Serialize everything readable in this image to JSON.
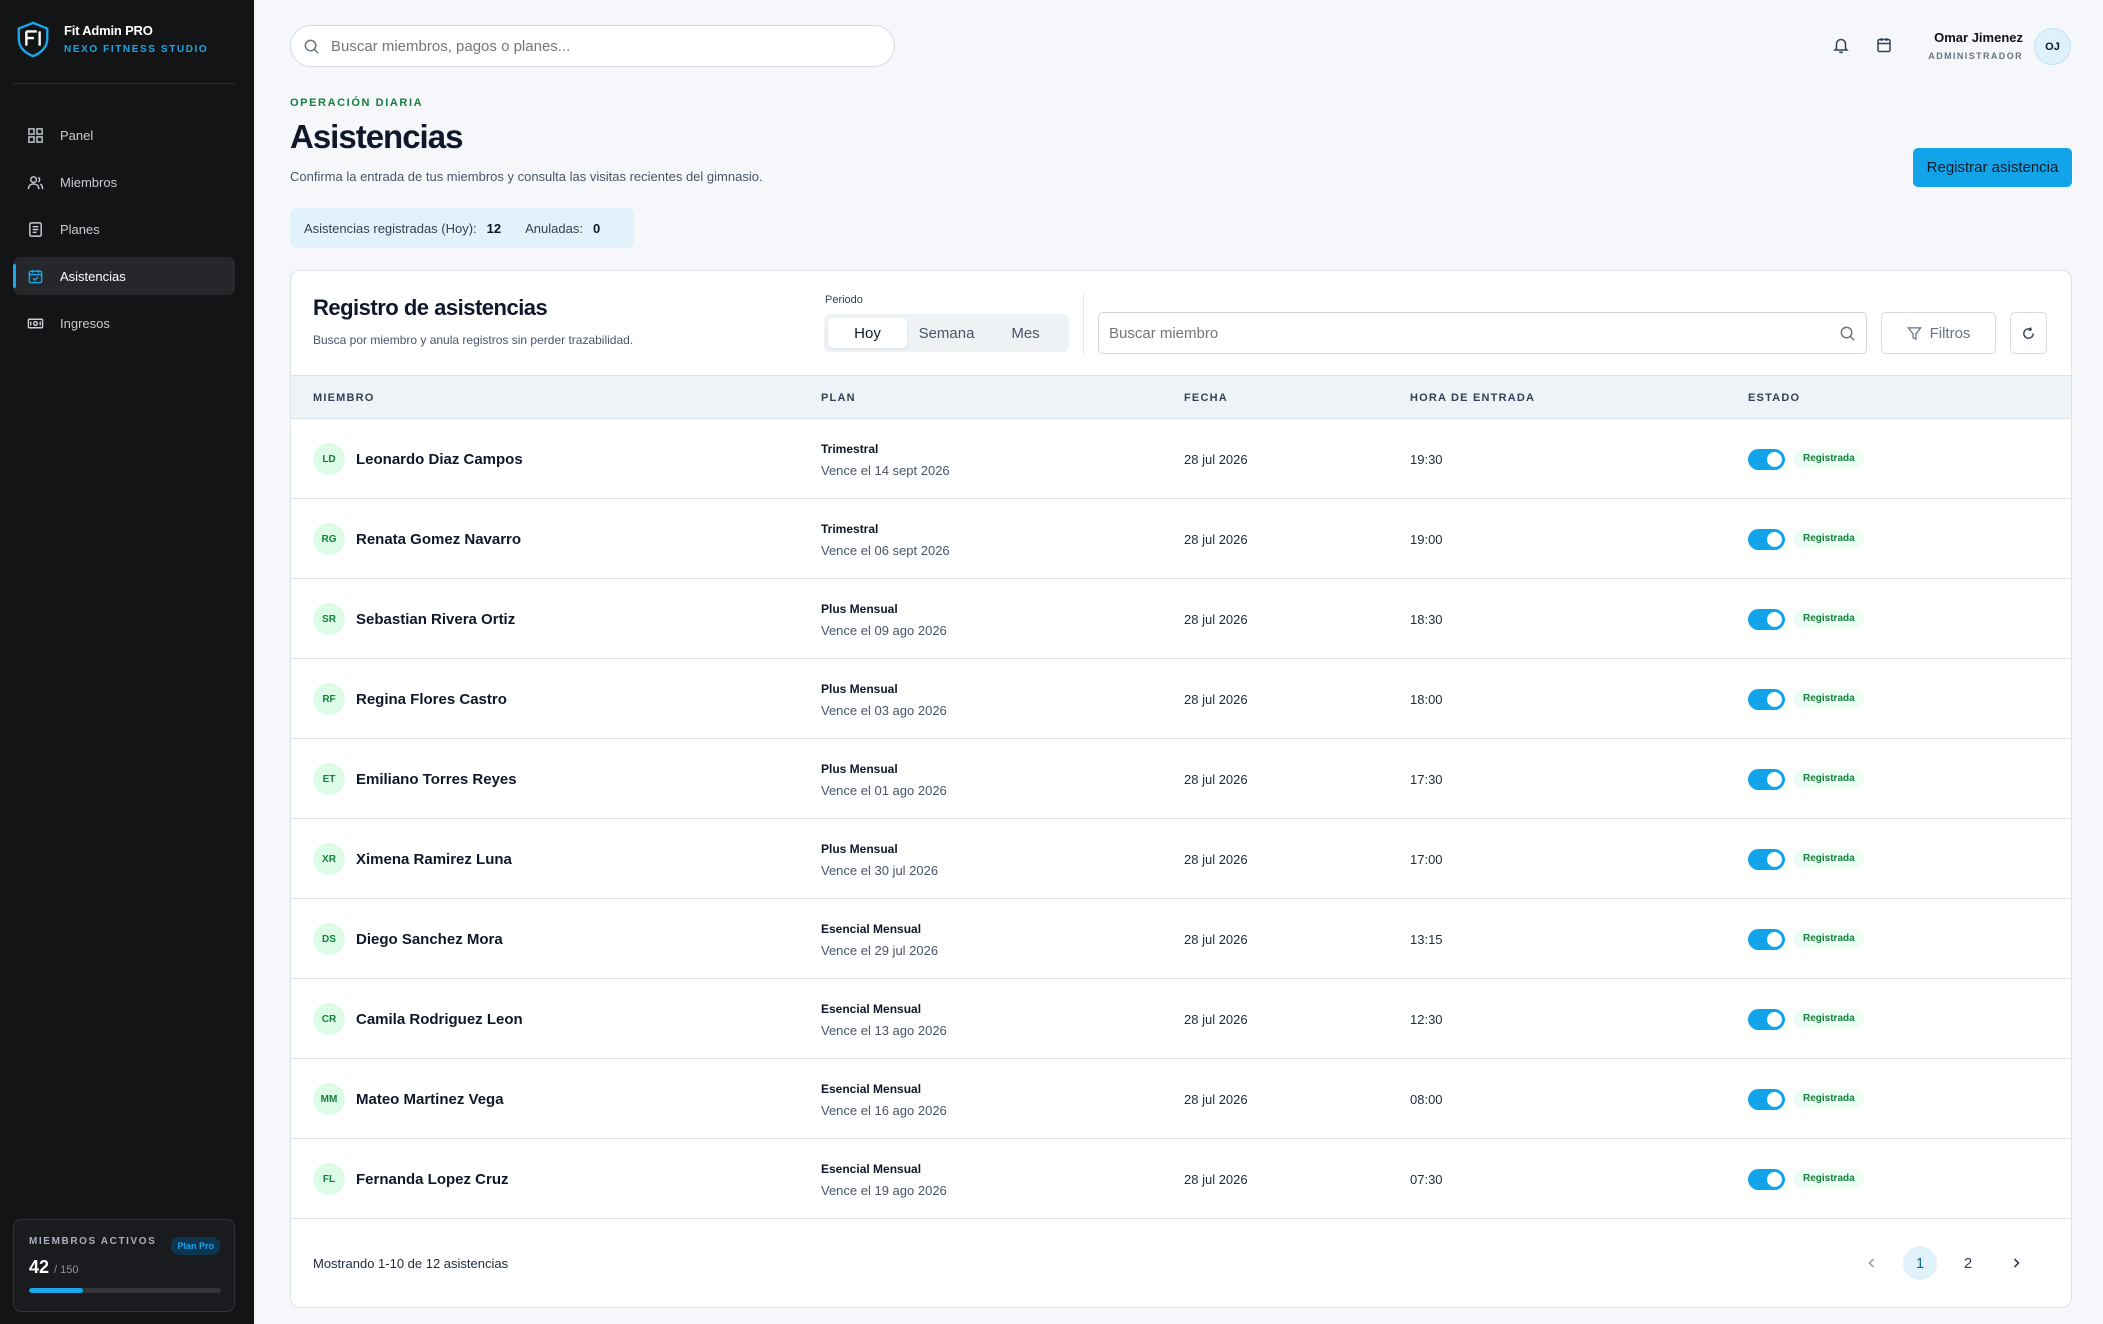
{
  "brand": {
    "title": "Fit Admin PRO",
    "subtitle": "NEXO FITNESS STUDIO"
  },
  "nav": [
    {
      "label": "Panel",
      "icon": "grid-icon"
    },
    {
      "label": "Miembros",
      "icon": "users-icon"
    },
    {
      "label": "Planes",
      "icon": "document-icon"
    },
    {
      "label": "Asistencias",
      "icon": "calendar-check-icon",
      "active": true
    },
    {
      "label": "Ingresos",
      "icon": "cash-icon"
    }
  ],
  "member_card": {
    "label": "MIEMBROS ACTIVOS",
    "badge": "Plan Pro",
    "count": "42",
    "total": "/ 150",
    "progress": 0.28
  },
  "topbar": {
    "search_placeholder": "Buscar miembros, pagos o planes...",
    "user_name": "Omar Jimenez",
    "user_role": "ADMINISTRADOR",
    "user_initials": "OJ"
  },
  "header": {
    "eyebrow": "OPERACIÓN DIARIA",
    "title": "Asistencias",
    "description": "Confirma la entrada de tus miembros y consulta las visitas recientes del gimnasio.",
    "primary_button": "Registrar asistencia"
  },
  "stats": {
    "registered_label": "Asistencias registradas (Hoy):",
    "registered_value": "12",
    "voided_label": "Anuladas:",
    "voided_value": "0"
  },
  "registry": {
    "title": "Registro de asistencias",
    "subtitle": "Busca por miembro y anula registros sin perder trazabilidad.",
    "period_label": "Periodo",
    "periods": [
      "Hoy",
      "Semana",
      "Mes"
    ],
    "search_placeholder": "Buscar miembro",
    "filters_label": "Filtros",
    "columns": [
      "MIEMBRO",
      "PLAN",
      "FECHA",
      "HORA DE ENTRADA",
      "ESTADO"
    ],
    "rows": [
      {
        "initials": "LD",
        "name": "Leonardo Diaz Campos",
        "plan": "Trimestral",
        "expires": "Vence el 14 sept 2026",
        "date": "28 jul 2026",
        "time": "19:30",
        "status": "Registrada"
      },
      {
        "initials": "RG",
        "name": "Renata Gomez Navarro",
        "plan": "Trimestral",
        "expires": "Vence el 06 sept 2026",
        "date": "28 jul 2026",
        "time": "19:00",
        "status": "Registrada"
      },
      {
        "initials": "SR",
        "name": "Sebastian Rivera Ortiz",
        "plan": "Plus Mensual",
        "expires": "Vence el 09 ago 2026",
        "date": "28 jul 2026",
        "time": "18:30",
        "status": "Registrada"
      },
      {
        "initials": "RF",
        "name": "Regina Flores Castro",
        "plan": "Plus Mensual",
        "expires": "Vence el 03 ago 2026",
        "date": "28 jul 2026",
        "time": "18:00",
        "status": "Registrada"
      },
      {
        "initials": "ET",
        "name": "Emiliano Torres Reyes",
        "plan": "Plus Mensual",
        "expires": "Vence el 01 ago 2026",
        "date": "28 jul 2026",
        "time": "17:30",
        "status": "Registrada"
      },
      {
        "initials": "XR",
        "name": "Ximena Ramirez Luna",
        "plan": "Plus Mensual",
        "expires": "Vence el 30 jul 2026",
        "date": "28 jul 2026",
        "time": "17:00",
        "status": "Registrada"
      },
      {
        "initials": "DS",
        "name": "Diego Sanchez Mora",
        "plan": "Esencial Mensual",
        "expires": "Vence el 29 jul 2026",
        "date": "28 jul 2026",
        "time": "13:15",
        "status": "Registrada"
      },
      {
        "initials": "CR",
        "name": "Camila Rodriguez Leon",
        "plan": "Esencial Mensual",
        "expires": "Vence el 13 ago 2026",
        "date": "28 jul 2026",
        "time": "12:30",
        "status": "Registrada"
      },
      {
        "initials": "MM",
        "name": "Mateo Martinez Vega",
        "plan": "Esencial Mensual",
        "expires": "Vence el 16 ago 2026",
        "date": "28 jul 2026",
        "time": "08:00",
        "status": "Registrada"
      },
      {
        "initials": "FL",
        "name": "Fernanda Lopez Cruz",
        "plan": "Esencial Mensual",
        "expires": "Vence el 19 ago 2026",
        "date": "28 jul 2026",
        "time": "07:30",
        "status": "Registrada"
      }
    ],
    "footer": "Mostrando 1-10 de 12 asistencias",
    "pages": [
      "1",
      "2"
    ]
  },
  "colors": {
    "accent": "#12a3e9",
    "sidebar_bg": "#131416",
    "success": "#15803d"
  }
}
